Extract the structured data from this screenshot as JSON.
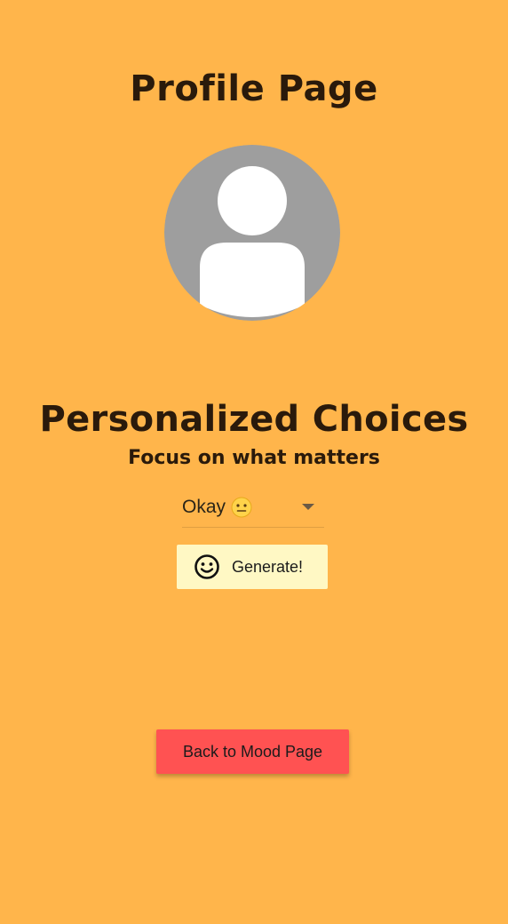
{
  "page": {
    "title": "Profile Page",
    "background_color": "#FFB54B"
  },
  "avatar": {
    "icon": "default-user-avatar-icon",
    "bg_color": "#9E9E9E",
    "fg_color": "#FFFFFF"
  },
  "section": {
    "title": "Personalized Choices",
    "subtitle": "Focus on what matters"
  },
  "mood_select": {
    "value_text": "Okay",
    "value_emoji": "neutral-face-emoji",
    "icon": "dropdown-arrow-icon"
  },
  "generate_button": {
    "label": "Generate!",
    "icon": "smiley-face-icon",
    "bg_color": "#FFF8C4"
  },
  "back_button": {
    "label": "Back to Mood Page",
    "bg_color": "#FF5252"
  }
}
